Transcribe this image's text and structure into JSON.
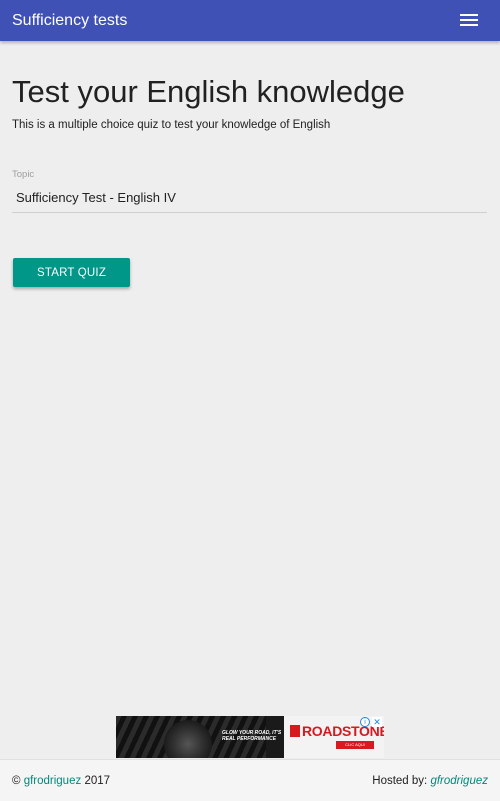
{
  "navbar": {
    "title": "Sufficiency tests",
    "menu_icon": "hamburger-menu-icon",
    "color": "#3f51b5"
  },
  "main": {
    "heading": "Test your English knowledge",
    "description": "This is a multiple choice quiz to test your knowledge of English",
    "topic": {
      "label": "Topic",
      "value": "Sufficiency Test - English IV"
    },
    "start_button": {
      "label": "START QUIZ",
      "color": "#009688"
    }
  },
  "ad": {
    "slogan": "GLOW YOUR ROAD, IT'S REAL PERFORMANCE",
    "brand": "ROADSTONE",
    "cta": "CLIC AQUI",
    "info_icon": "info-icon",
    "close_icon": "close-icon"
  },
  "footer": {
    "copyright_symbol": "©",
    "author_link": "gfrodriguez",
    "year": "2017",
    "hosted_label": "Hosted by:",
    "host_link": "gfrodriguez",
    "link_color": "#00897b"
  }
}
